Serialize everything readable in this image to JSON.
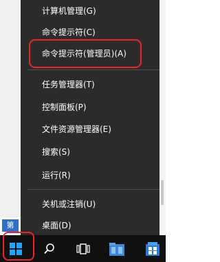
{
  "colors": {
    "menu_bg": "#2b2b2b",
    "menu_text": "#ffffff",
    "taskbar_bg": "#101010",
    "start_blue": "#1ea7ff",
    "highlight_red": "#e8262a",
    "side_label_bg": "#2f6fc8"
  },
  "side_label": "第",
  "menu": {
    "items": [
      {
        "label": "计算机管理(G)"
      },
      {
        "label": "命令提示符(C)"
      },
      {
        "label": "命令提示符(管理员)(A)"
      },
      {
        "label": "任务管理器(T)"
      },
      {
        "label": "控制面板(P)"
      },
      {
        "label": "文件资源管理器(E)"
      },
      {
        "label": "搜索(S)"
      },
      {
        "label": "运行(R)"
      },
      {
        "label": "关机或注销(U)"
      },
      {
        "label": "桌面(D)"
      }
    ]
  },
  "taskbar": {
    "icons": [
      "windows-start-icon",
      "search-icon",
      "task-view-icon",
      "file-explorer-icon",
      "store-icon"
    ]
  }
}
